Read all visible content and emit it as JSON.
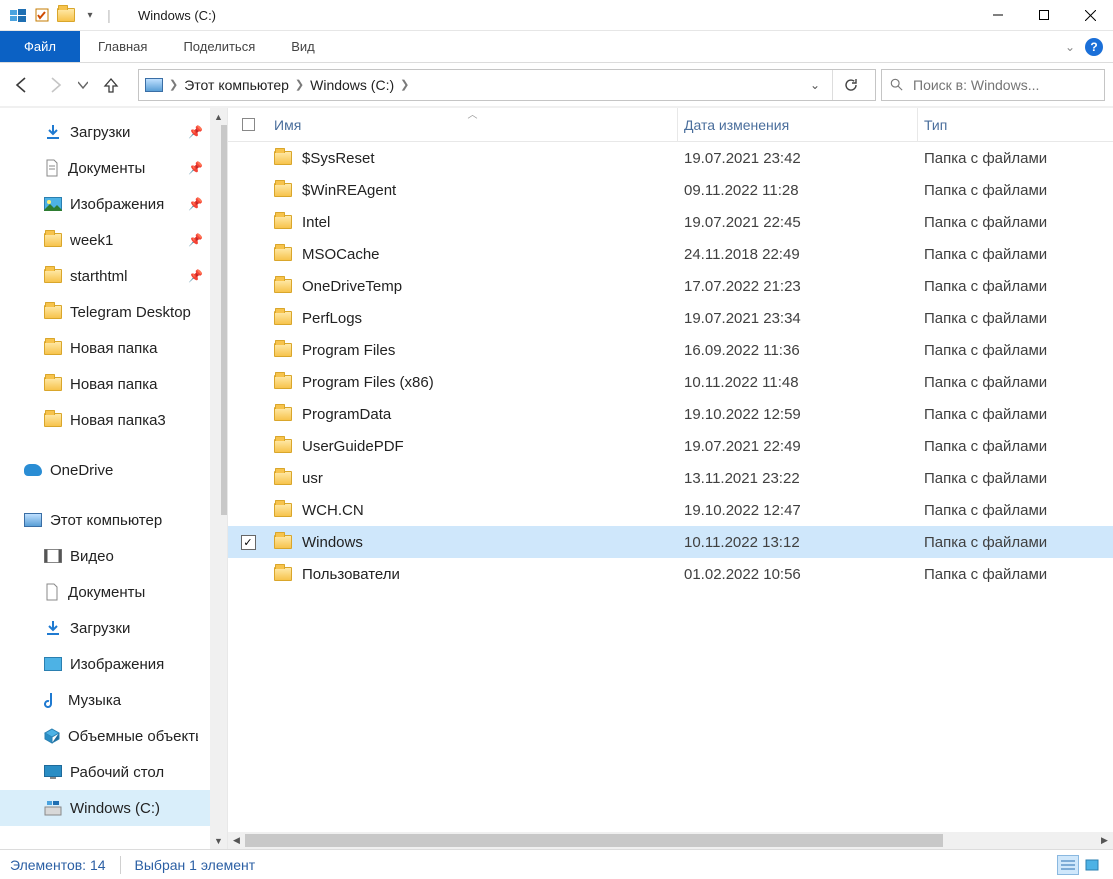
{
  "window": {
    "title": "Windows (C:)"
  },
  "ribbon": {
    "file": "Файл",
    "home": "Главная",
    "share": "Поделиться",
    "view": "Вид"
  },
  "breadcrumb": {
    "root": "Этот компьютер",
    "drive": "Windows (C:)"
  },
  "search": {
    "placeholder": "Поиск в: Windows..."
  },
  "nav": {
    "downloads": "Загрузки",
    "documents": "Документы",
    "pictures": "Изображения",
    "week1": "week1",
    "starthtml": "starthtml",
    "telegram": "Telegram Desktop",
    "newfolder1": "Новая папка",
    "newfolder2": "Новая папка",
    "newfolder3": "Новая папка3",
    "onedrive": "OneDrive",
    "thispc": "Этот компьютер",
    "video": "Видео",
    "documents2": "Документы",
    "downloads2": "Загрузки",
    "pictures2": "Изображения",
    "music": "Музыка",
    "objects3d": "Объемные объекты",
    "desktop": "Рабочий стол",
    "drivec": "Windows (C:)"
  },
  "columns": {
    "name": "Имя",
    "date": "Дата изменения",
    "type": "Тип"
  },
  "type_folder": "Папка с файлами",
  "files": [
    {
      "name": "$SysReset",
      "date": "19.07.2021 23:42"
    },
    {
      "name": "$WinREAgent",
      "date": "09.11.2022 11:28"
    },
    {
      "name": "Intel",
      "date": "19.07.2021 22:45"
    },
    {
      "name": "MSOCache",
      "date": "24.11.2018 22:49"
    },
    {
      "name": "OneDriveTemp",
      "date": "17.07.2022 21:23"
    },
    {
      "name": "PerfLogs",
      "date": "19.07.2021 23:34"
    },
    {
      "name": "Program Files",
      "date": "16.09.2022 11:36"
    },
    {
      "name": "Program Files (x86)",
      "date": "10.11.2022 11:48"
    },
    {
      "name": "ProgramData",
      "date": "19.10.2022 12:59"
    },
    {
      "name": "UserGuidePDF",
      "date": "19.07.2021 22:49"
    },
    {
      "name": "usr",
      "date": "13.11.2021 23:22"
    },
    {
      "name": "WCH.CN",
      "date": "19.10.2022 12:47"
    },
    {
      "name": "Windows",
      "date": "10.11.2022 13:12",
      "selected": true
    },
    {
      "name": "Пользователи",
      "date": "01.02.2022 10:56"
    }
  ],
  "status": {
    "count": "Элементов: 14",
    "selection": "Выбран 1 элемент"
  }
}
